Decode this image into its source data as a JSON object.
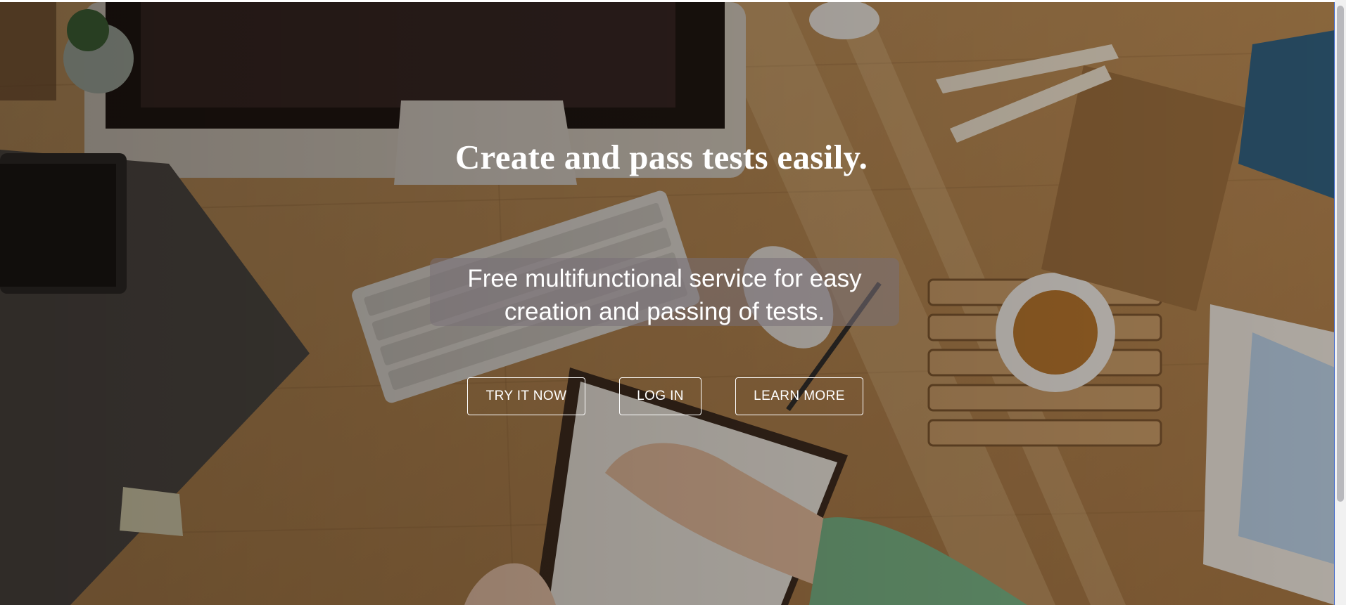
{
  "hero": {
    "headline": "Create and pass tests easily.",
    "subtitle_line1": "Free multifunctional service for easy",
    "subtitle_line2": "creation and passing of tests.",
    "background": "desk workspace photo"
  },
  "buttons": {
    "try_label": "TRY IT NOW",
    "login_label": "LOG IN",
    "learn_label": "LEARN MORE"
  },
  "colors": {
    "text": "#ffffff",
    "button_border": "#ffffff",
    "subtitle_backdrop": "#786f76"
  }
}
